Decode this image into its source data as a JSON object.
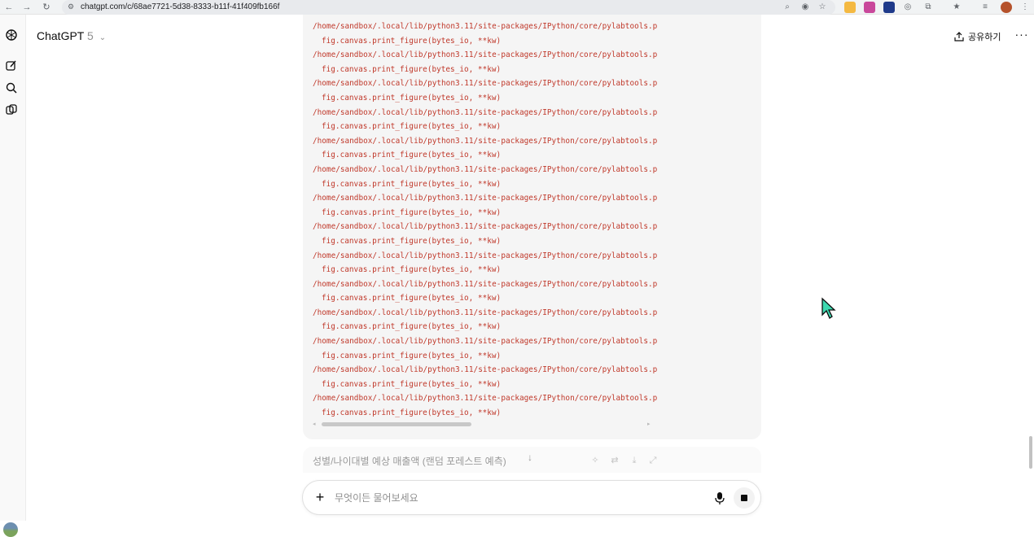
{
  "browser": {
    "url": "chatgpt.com/c/68ae7721-5d38-8333-b11f-41f409fb166f",
    "back_icon": "back-arrow-icon",
    "forward_icon": "forward-arrow-icon",
    "reload_icon": "reload-icon"
  },
  "header": {
    "app_name": "ChatGPT",
    "model_version": "5",
    "share_label": "공유하기",
    "more_label": "···"
  },
  "code_output": {
    "lines": [
      {
        "path": "/home/sandbox/.local/lib/python3.11/site-packages/IPython/core/pylabtools.p",
        "call": "fig.canvas.print_figure(bytes_io, **kw)"
      },
      {
        "path": "/home/sandbox/.local/lib/python3.11/site-packages/IPython/core/pylabtools.p",
        "call": "fig.canvas.print_figure(bytes_io, **kw)"
      },
      {
        "path": "/home/sandbox/.local/lib/python3.11/site-packages/IPython/core/pylabtools.p",
        "call": "fig.canvas.print_figure(bytes_io, **kw)"
      },
      {
        "path": "/home/sandbox/.local/lib/python3.11/site-packages/IPython/core/pylabtools.p",
        "call": "fig.canvas.print_figure(bytes_io, **kw)"
      },
      {
        "path": "/home/sandbox/.local/lib/python3.11/site-packages/IPython/core/pylabtools.p",
        "call": "fig.canvas.print_figure(bytes_io, **kw)"
      },
      {
        "path": "/home/sandbox/.local/lib/python3.11/site-packages/IPython/core/pylabtools.p",
        "call": "fig.canvas.print_figure(bytes_io, **kw)"
      },
      {
        "path": "/home/sandbox/.local/lib/python3.11/site-packages/IPython/core/pylabtools.p",
        "call": "fig.canvas.print_figure(bytes_io, **kw)"
      },
      {
        "path": "/home/sandbox/.local/lib/python3.11/site-packages/IPython/core/pylabtools.p",
        "call": "fig.canvas.print_figure(bytes_io, **kw)"
      },
      {
        "path": "/home/sandbox/.local/lib/python3.11/site-packages/IPython/core/pylabtools.p",
        "call": "fig.canvas.print_figure(bytes_io, **kw)"
      },
      {
        "path": "/home/sandbox/.local/lib/python3.11/site-packages/IPython/core/pylabtools.p",
        "call": "fig.canvas.print_figure(bytes_io, **kw)"
      },
      {
        "path": "/home/sandbox/.local/lib/python3.11/site-packages/IPython/core/pylabtools.p",
        "call": "fig.canvas.print_figure(bytes_io, **kw)"
      },
      {
        "path": "/home/sandbox/.local/lib/python3.11/site-packages/IPython/core/pylabtools.p",
        "call": "fig.canvas.print_figure(bytes_io, **kw)"
      },
      {
        "path": "/home/sandbox/.local/lib/python3.11/site-packages/IPython/core/pylabtools.p",
        "call": "fig.canvas.print_figure(bytes_io, **kw)"
      },
      {
        "path": "/home/sandbox/.local/lib/python3.11/site-packages/IPython/core/pylabtools.p",
        "call": "fig.canvas.print_figure(bytes_io, **kw)"
      }
    ]
  },
  "output_panel": {
    "title": "성별/나이대별 예상 매출액 (랜덤 포레스트 예측)"
  },
  "composer": {
    "placeholder": "무엇이든 물어보세요"
  },
  "colors": {
    "code_text": "#c0392b",
    "code_bg": "#f5f5f5",
    "cursor": "#3dd9b0"
  }
}
